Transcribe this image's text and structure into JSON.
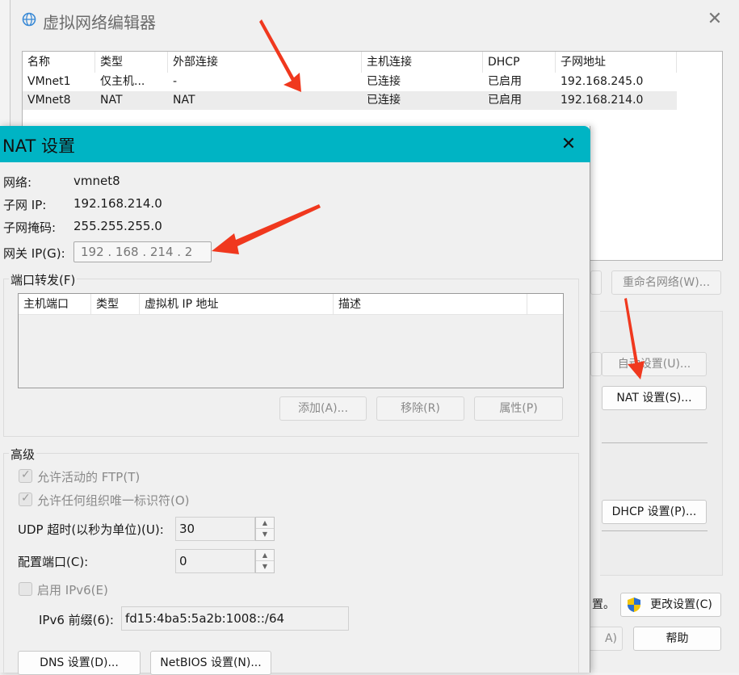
{
  "vne": {
    "title": "虚拟网络编辑器",
    "columns": [
      "名称",
      "类型",
      "外部连接",
      "主机连接",
      "DHCP",
      "子网地址"
    ],
    "rows": [
      {
        "name": "VMnet1",
        "type": "仅主机...",
        "external": "-",
        "host": "已连接",
        "dhcp": "已启用",
        "subnet": "192.168.245.0"
      },
      {
        "name": "VMnet8",
        "type": "NAT",
        "external": "NAT",
        "host": "已连接",
        "dhcp": "已启用",
        "subnet": "192.168.214.0"
      }
    ],
    "rename_button": "重命名网络(W)...",
    "auto_button": "自动设置(U)...",
    "nat_button": "NAT 设置(S)...",
    "dhcp_button": "DHCP 设置(P)...",
    "partial_text": "置。",
    "change_button": "更改设置(C)",
    "partial_button": "A)",
    "help_button": "帮助"
  },
  "nat": {
    "title": "NAT 设置",
    "network_label": "网络:",
    "network_value": "vmnet8",
    "subnet_ip_label": "子网 IP:",
    "subnet_ip_value": "192.168.214.0",
    "mask_label": "子网掩码:",
    "mask_value": "255.255.255.0",
    "gateway_label": "网关 IP(G):",
    "gateway_value": "192 . 168 . 214 .   2",
    "port_forward_title": "端口转发(F)",
    "pf_columns": [
      "主机端口",
      "类型",
      "虚拟机 IP 地址",
      "描述"
    ],
    "add_button": "添加(A)...",
    "remove_button": "移除(R)",
    "props_button": "属性(P)",
    "advanced_title": "高级",
    "allow_ftp": "允许活动的 FTP(T)",
    "allow_oui": "允许任何组织唯一标识符(O)",
    "udp_label": "UDP 超时(以秒为单位)(U):",
    "udp_value": "30",
    "config_port_label": "配置端口(C):",
    "config_port_value": "0",
    "ipv6_enable": "启用 IPv6(E)",
    "ipv6_prefix_label": "IPv6 前缀(6):",
    "ipv6_prefix_value": "fd15:4ba5:5a2b:1008::/64",
    "dns_button": "DNS 设置(D)...",
    "netbios_button": "NetBIOS 设置(N)..."
  }
}
